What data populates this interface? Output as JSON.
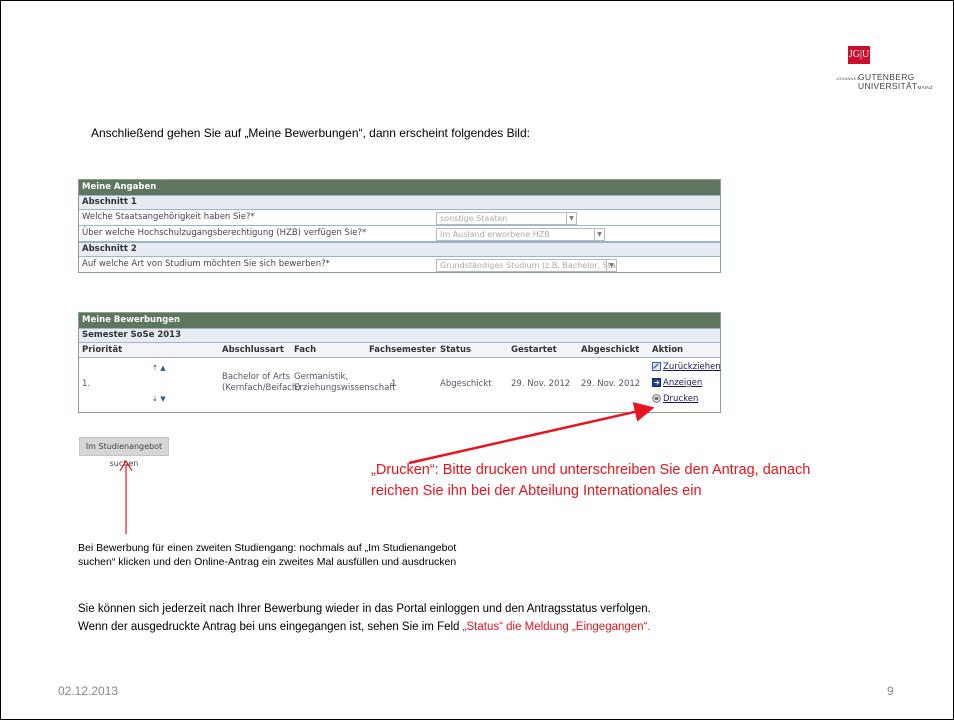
{
  "logo": {
    "box_text": "JG|U",
    "line_small": "JOHANNES",
    "line1": "GUTENBERG",
    "line2": "UNIVERSITÄT",
    "line2_suffix": "MAINZ"
  },
  "intro": "Anschließend gehen Sie auf „Meine Bewerbungen“, dann erscheint folgendes Bild:",
  "meine_angaben": {
    "title": "Meine Angaben",
    "sections": [
      {
        "title": "Abschnitt 1",
        "rows": [
          {
            "label": "Welche Staatsangehörigkeit haben Sie?*",
            "value": "sonstige Staaten"
          },
          {
            "label": "Über welche Hochschulzugangsberechtigung (HZB) verfügen Sie?*",
            "value": "Im Ausland erworbene HZB"
          }
        ]
      },
      {
        "title": "Abschnitt 2",
        "rows": [
          {
            "label": "Auf welche Art von Studium möchten Sie sich bewerben?*",
            "value": "Grundständiges Studium (z.B. Bachelor, Staatsex."
          }
        ]
      }
    ]
  },
  "meine_bewerbungen": {
    "title": "Meine Bewerbungen",
    "semester": "Semester SoSe 2013",
    "columns": [
      "Priorität",
      "Abschlussart",
      "Fach",
      "Fachsemester",
      "Status",
      "Gestartet",
      "Abgeschickt",
      "Aktion"
    ],
    "row": {
      "prioritaet": "1.",
      "abschlussart_1": "Bachelor of Arts",
      "abschlussart_2": "(Kernfach/Beifach)",
      "fach_1": "Germanistik,",
      "fach_2": "Erziehungswissenschaft",
      "fachsemester": "1",
      "status": "Abgeschickt",
      "gestartet": "29. Nov. 2012",
      "abgeschickt": "29. Nov. 2012",
      "actions": [
        "Zurückziehen",
        "Anzeigen",
        "Drucken"
      ]
    }
  },
  "search_button": "Im Studienangebot suchen",
  "callout": {
    "line1": "„Drucken“:  Bitte drucken und unterschreiben Sie den Antrag, danach",
    "line2": "reichen Sie ihn bei der Abteilung Internationales ein"
  },
  "note": {
    "line1": "Bei Bewerbung für einen zweiten Studiengang: nochmals auf „Im Studienangebot",
    "line2": "suchen“ klicken und den Online-Antrag ein zweites Mal  ausfüllen und ausdrucken"
  },
  "info": {
    "line1": "Sie können sich jederzeit nach Ihrer Bewerbung wieder in das Portal einloggen und den Antragsstatus verfolgen.",
    "line2_a": "Wenn der ausgedruckte Antrag bei uns eingegangen ist, sehen Sie im Feld ",
    "line2_b": "„Status“ die Meldung „Eingegangen“."
  },
  "footer": {
    "date": "02.12.2013",
    "page": "9"
  },
  "colors": {
    "panel_header": "#5e7560",
    "callout_red": "#e8141e"
  }
}
